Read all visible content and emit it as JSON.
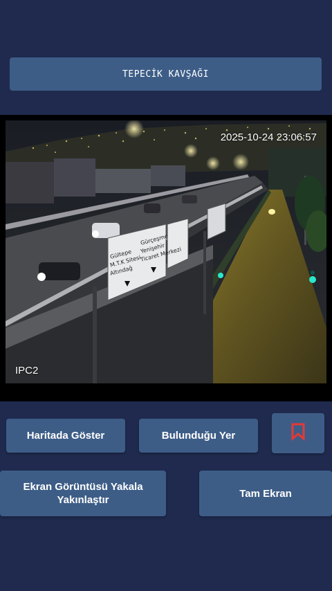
{
  "header": {
    "title": "TEPECİK KAVŞAĞI"
  },
  "camera": {
    "timestamp": "2025-10-24 23:06:57",
    "camera_id": "IPC2",
    "sign_left_lines": [
      "Gültepe",
      "M.T.K Sitesi",
      "Altındağ"
    ],
    "sign_middle_lines": [
      "Gürçeşme",
      "Yenişehir",
      "Ticaret Merkezi"
    ]
  },
  "actions": {
    "show_on_map": "Haritada Göster",
    "location": "Bulunduğu Yer",
    "capture_line1": "Ekran Görüntüsü Yakala",
    "capture_line2": "Yakınlaştır",
    "fullscreen": "Tam Ekran",
    "bookmark_icon": "bookmark-icon"
  },
  "colors": {
    "background": "#1f2a4e",
    "button": "#3d5d87",
    "bookmark": "#e53935"
  }
}
